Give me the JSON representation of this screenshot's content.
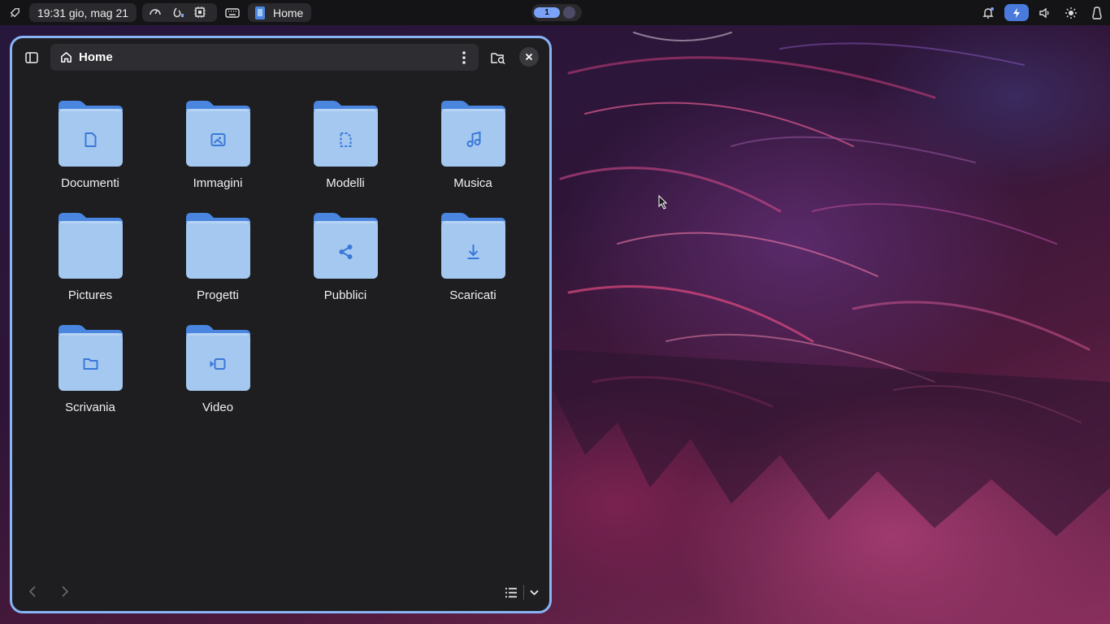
{
  "topbar": {
    "clock": "19:31 gio, mag 21",
    "active_window": "Home",
    "workspace": "1",
    "icons": [
      "rocket-icon",
      "speedometer-icon",
      "temperature-icon",
      "cpu-icon",
      "keyboard-icon",
      "app-icon",
      "bell-icon",
      "battery-charging-icon",
      "volume-icon",
      "brightness-icon",
      "tux-icon"
    ]
  },
  "window": {
    "path_label": "Home",
    "folders": [
      {
        "name": "Documenti",
        "icon": "document-icon"
      },
      {
        "name": "Immagini",
        "icon": "image-icon"
      },
      {
        "name": "Modelli",
        "icon": "template-icon"
      },
      {
        "name": "Musica",
        "icon": "music-icon"
      },
      {
        "name": "Pictures",
        "icon": ""
      },
      {
        "name": "Progetti",
        "icon": ""
      },
      {
        "name": "Pubblici",
        "icon": "share-icon"
      },
      {
        "name": "Scaricati",
        "icon": "download-icon"
      },
      {
        "name": "Scrivania",
        "icon": "desktop-folder-icon"
      },
      {
        "name": "Video",
        "icon": "video-icon"
      }
    ]
  },
  "colors": {
    "accent": "#89b4f6",
    "folder_back": "#4a86e0",
    "folder_front": "#a4c8f0",
    "folder_glyph": "#3a78d8",
    "window_bg": "#1e1e21",
    "topbar_bg": "#141416"
  }
}
